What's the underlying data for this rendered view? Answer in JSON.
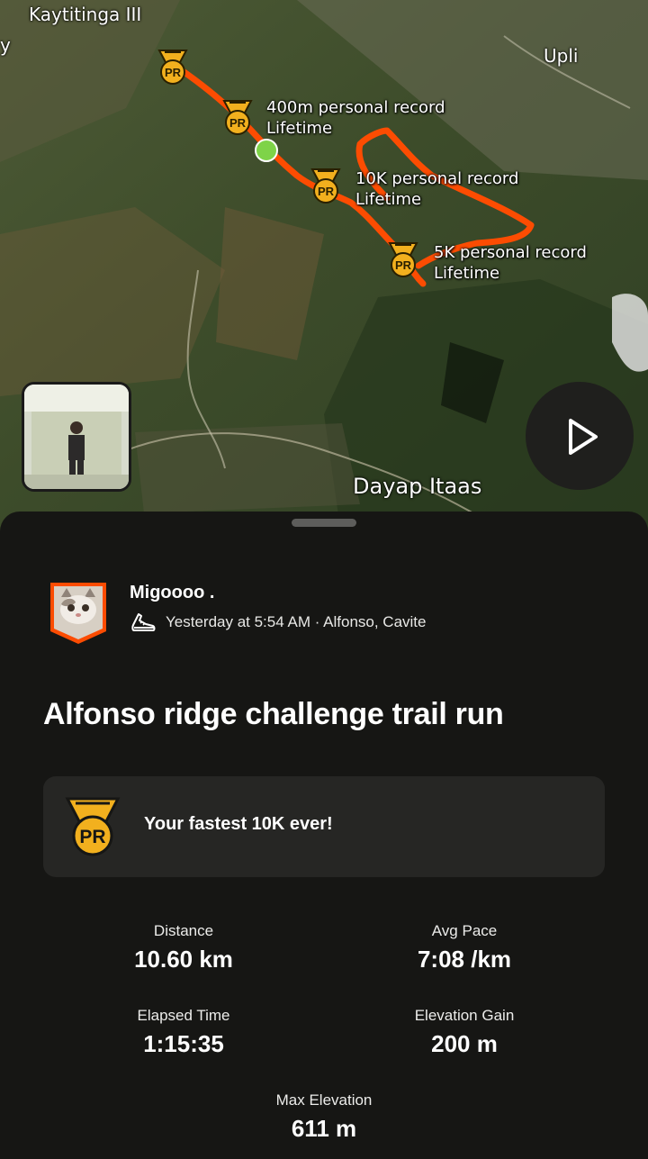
{
  "map": {
    "places": [
      {
        "name": "Kaytitinga III"
      },
      {
        "name": "y"
      },
      {
        "name": "Upli"
      },
      {
        "name": "Dayap Itaas"
      }
    ],
    "pr_markers": [
      {
        "badge": "PR",
        "line1": "",
        "line2": ""
      },
      {
        "badge": "PR",
        "line1": "400m personal record",
        "line2": "Lifetime"
      },
      {
        "badge": "PR",
        "line1": "10K personal record",
        "line2": "Lifetime"
      },
      {
        "badge": "PR",
        "line1": "5K personal record",
        "line2": "Lifetime"
      }
    ],
    "route_color": "#fc4c02",
    "start_marker_color": "#7ed348"
  },
  "colors": {
    "pr_gold": "#f2b01e",
    "accent": "#fc4c02"
  },
  "activity": {
    "athlete_name": "Migoooo .",
    "meta": "Yesterday at 5:54 AM · Alfonso, Cavite",
    "sport_icon": "run-shoe-icon",
    "title": "Alfonso ridge challenge trail run"
  },
  "achievement": {
    "badge": "PR",
    "text": "Your fastest 10K ever!"
  },
  "stats": [
    {
      "label": "Distance",
      "value": "10.60 km"
    },
    {
      "label": "Avg Pace",
      "value": "7:08 /km"
    },
    {
      "label": "Elapsed Time",
      "value": "1:15:35"
    },
    {
      "label": "Elevation Gain",
      "value": "200 m"
    },
    {
      "label": "Max Elevation",
      "value": "611 m"
    }
  ]
}
